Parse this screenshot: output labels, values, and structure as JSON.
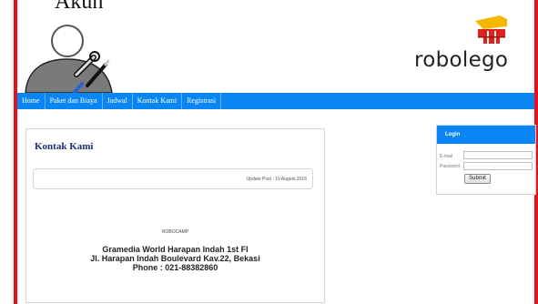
{
  "header": {
    "partial_text": "Akun"
  },
  "logo": {
    "text": "robolego"
  },
  "nav": {
    "items": [
      {
        "label": "Home"
      },
      {
        "label": "Paket dan Biaya"
      },
      {
        "label": "Jadwal"
      },
      {
        "label": "Kontak Kami"
      },
      {
        "label": "Registrasi"
      }
    ]
  },
  "main": {
    "title": "Kontak Kami",
    "update_post": "Update Post : 10 August 2016",
    "org": "ROBOCAMP",
    "address_line1": "Gramedia World Harapan Indah 1st Fl",
    "address_line2": "Jl. Harapan Indah Boulevard Kav.22, Bekasi",
    "phone": "Phone : 021-88382860"
  },
  "login": {
    "title": "Login",
    "email_label": "E-mail",
    "password_label": "Password",
    "email_value": "",
    "password_value": "",
    "submit_label": "Submit"
  },
  "colors": {
    "accent": "#0a86f4",
    "border_red": "#e8101a",
    "title_navy": "#1a2f76"
  }
}
